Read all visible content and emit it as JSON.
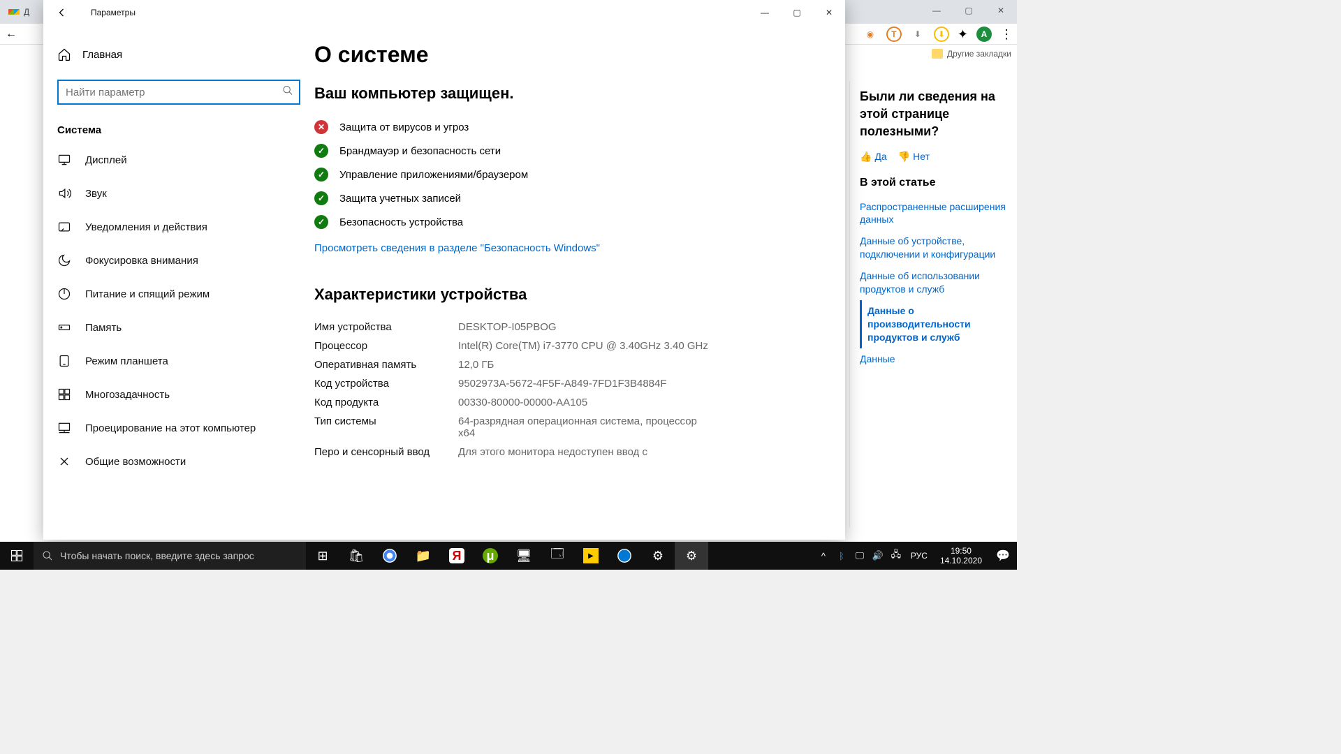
{
  "browser": {
    "tab_label": "Д",
    "bookmarks_label": "Другие закладки",
    "avatar_letter": "A"
  },
  "settings": {
    "window_title": "Параметры",
    "home_label": "Главная",
    "search_placeholder": "Найти параметр",
    "category": "Система",
    "sidebar": {
      "items": [
        {
          "label": "Дисплей"
        },
        {
          "label": "Звук"
        },
        {
          "label": "Уведомления и действия"
        },
        {
          "label": "Фокусировка внимания"
        },
        {
          "label": "Питание и спящий режим"
        },
        {
          "label": "Память"
        },
        {
          "label": "Режим планшета"
        },
        {
          "label": "Многозадачность"
        },
        {
          "label": "Проецирование на этот компьютер"
        },
        {
          "label": "Общие возможности"
        }
      ]
    },
    "content": {
      "title": "О системе",
      "protected_heading": "Ваш компьютер защищен.",
      "security_items": [
        {
          "status": "bad",
          "label": "Защита от вирусов и угроз"
        },
        {
          "status": "ok",
          "label": "Брандмауэр и безопасность сети"
        },
        {
          "status": "ok",
          "label": "Управление приложениями/браузером"
        },
        {
          "status": "ok",
          "label": "Защита учетных записей"
        },
        {
          "status": "ok",
          "label": "Безопасность устройства"
        }
      ],
      "security_link": "Просмотреть сведения в разделе \"Безопасность Windows\"",
      "specs_heading": "Характеристики устройства",
      "specs": [
        {
          "label": "Имя устройства",
          "value": "DESKTOP-I05PBOG"
        },
        {
          "label": "Процессор",
          "value": "Intel(R) Core(TM) i7-3770 CPU @ 3.40GHz 3.40 GHz"
        },
        {
          "label": "Оперативная память",
          "value": "12,0 ГБ"
        },
        {
          "label": "Код устройства",
          "value": "9502973A-5672-4F5F-A849-7FD1F3B4884F"
        },
        {
          "label": "Код продукта",
          "value": "00330-80000-00000-AA105"
        },
        {
          "label": "Тип системы",
          "value": "64-разрядная операционная система, процессор x64"
        },
        {
          "label": "Перо и сенсорный ввод",
          "value": "Для этого монитора недоступен ввод с"
        }
      ]
    }
  },
  "docs": {
    "feedback_q": "Были ли сведения на этой странице полезными?",
    "yes": "Да",
    "no": "Нет",
    "section": "В этой статье",
    "links": [
      "Распространенные расширения данных",
      "Данные об устройстве, подключении и конфигурации",
      "Данные об использовании продуктов и служб",
      "Данные о производительности продуктов и служб",
      "Данные"
    ]
  },
  "taskbar": {
    "search_placeholder": "Чтобы начать поиск, введите здесь запрос",
    "lang": "РУС",
    "time": "19:50",
    "date": "14.10.2020"
  }
}
